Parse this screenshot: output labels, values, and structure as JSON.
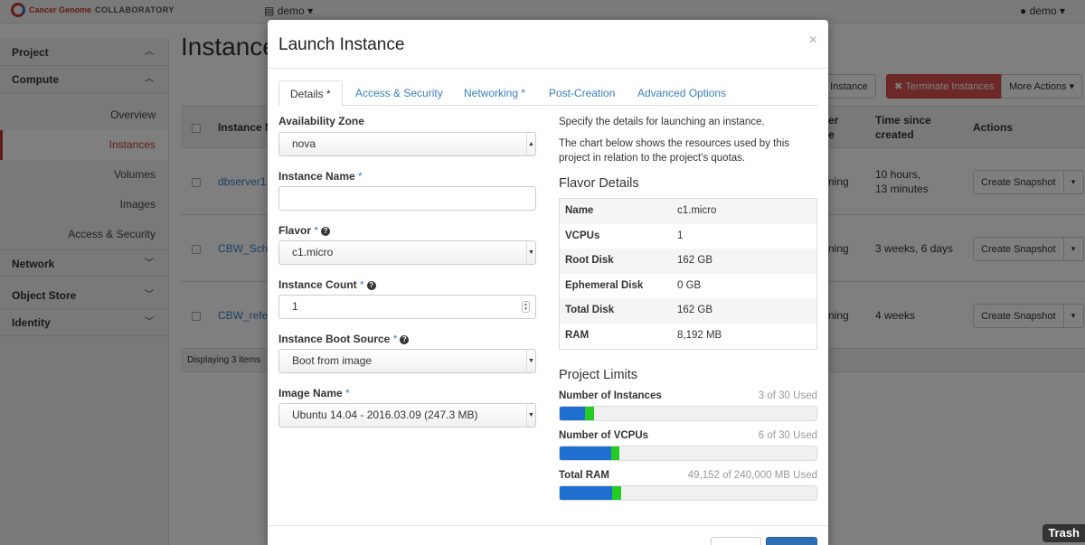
{
  "app": {
    "logo_text": "Cancer Genome",
    "logo_subtext": "COLLABORATORY",
    "project_selector": "demo",
    "user_menu": "demo"
  },
  "sidebar": {
    "sections": [
      {
        "label": "Project"
      },
      {
        "label": "Compute"
      },
      {
        "label": "Network"
      },
      {
        "label": "Object Store"
      },
      {
        "label": "Identity"
      }
    ],
    "items": [
      {
        "label": "Overview"
      },
      {
        "label": "Instances"
      },
      {
        "label": "Volumes"
      },
      {
        "label": "Images"
      },
      {
        "label": "Access & Security"
      }
    ]
  },
  "page": {
    "title": "Instances",
    "launch_btn_partial": "h Instance",
    "terminate_btn": "Terminate Instances",
    "more_actions_btn": "More Actions",
    "columns": {
      "name_partial": "Instance N",
      "power_a": "er",
      "power_b": "e",
      "time_since": "Time since",
      "time_since_2": "created",
      "actions": "Actions"
    },
    "rows": [
      {
        "name": "dbserver1",
        "state_partial": "ning",
        "time": "10 hours,",
        "time2": "13 minutes",
        "action": "Create Snapshot"
      },
      {
        "name": "CBW_Sche",
        "state_partial": "ning",
        "time": "3 weeks, 6 days",
        "time2": "",
        "action": "Create Snapshot"
      },
      {
        "name": "CBW_refer",
        "state_partial": "ning",
        "time": "4 weeks",
        "time2": "",
        "action": "Create Snapshot"
      }
    ],
    "footer": "Displaying 3 items"
  },
  "modal": {
    "title": "Launch Instance",
    "close_symbol": "×",
    "tabs": [
      {
        "label": "Details *"
      },
      {
        "label": "Access & Security"
      },
      {
        "label": "Networking *"
      },
      {
        "label": "Post-Creation"
      },
      {
        "label": "Advanced Options"
      }
    ],
    "fields": {
      "availability_zone": {
        "label": "Availability Zone",
        "value": "nova"
      },
      "instance_name": {
        "label": "Instance Name",
        "value": ""
      },
      "flavor": {
        "label": "Flavor",
        "value": "c1.micro"
      },
      "instance_count": {
        "label": "Instance Count",
        "value": "1"
      },
      "boot_source": {
        "label": "Instance Boot Source",
        "value": "Boot from image"
      },
      "image_name": {
        "label": "Image Name",
        "value": "Ubuntu 14.04 - 2016.03.09 (247.3 MB)"
      }
    },
    "required_mark": "*",
    "help_symbol": "?",
    "description_1": "Specify the details for launching an instance.",
    "description_2": "The chart below shows the resources used by this project in relation to the project's quotas.",
    "flavor_details": {
      "title": "Flavor Details",
      "rows": [
        {
          "key": "Name",
          "value": "c1.micro"
        },
        {
          "key": "VCPUs",
          "value": "1"
        },
        {
          "key": "Root Disk",
          "value": "162 GB"
        },
        {
          "key": "Ephemeral Disk",
          "value": "0 GB"
        },
        {
          "key": "Total Disk",
          "value": "162 GB"
        },
        {
          "key": "RAM",
          "value": "8,192 MB"
        }
      ]
    },
    "project_limits": {
      "title": "Project Limits",
      "limits": [
        {
          "name": "Number of Instances",
          "used_text": "3 of 30 Used",
          "used_fraction": 0.1,
          "added_fraction": 0.033
        },
        {
          "name": "Number of VCPUs",
          "used_text": "6 of 30 Used",
          "used_fraction": 0.2,
          "added_fraction": 0.033
        },
        {
          "name": "Total RAM",
          "used_text": "49,152 of 240,000 MB Used",
          "used_fraction": 0.205,
          "added_fraction": 0.034
        }
      ]
    }
  },
  "dock": {
    "trash_label": "Trash"
  },
  "colors": {
    "accent": "#c0392b",
    "link": "#3a7fc2",
    "bar_used": "#1f6fd1",
    "bar_added": "#22cc22"
  }
}
